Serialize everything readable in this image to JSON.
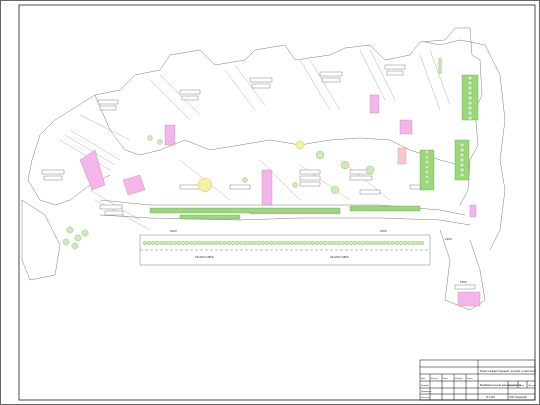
{
  "drawing": {
    "title_block": {
      "project": "Многоквартирный жилой комплекс",
      "sheet_title": "Разбивочный дендроплан",
      "sheet_no": "1",
      "scale": "М 1:200",
      "org": "ООО Ландшафт",
      "rows": [
        "Изм.",
        "Кол.уч.",
        "Лист",
        "№ док.",
        "Подп.",
        "Дата"
      ],
      "roles": [
        "Разраб.",
        "Проверил",
        "Н.контр.",
        "Утв."
      ],
      "cols": [
        "Стадия",
        "Лист",
        "Листов"
      ]
    },
    "dims": {
      "d1": "24x200=4800",
      "d2": "24x200=4800",
      "d3": "2000",
      "d4": "2000",
      "d5": "1000",
      "d6": "1500"
    }
  }
}
